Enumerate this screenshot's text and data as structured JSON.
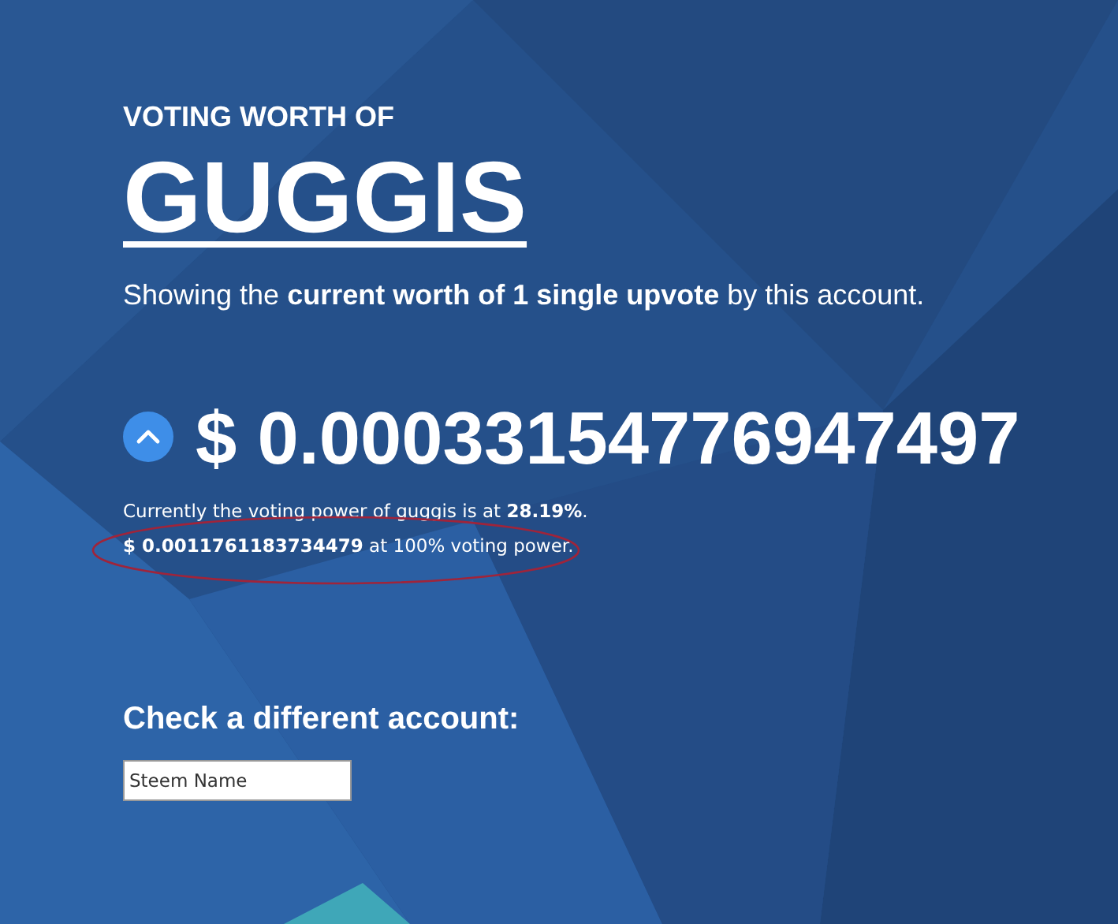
{
  "header": {
    "kicker": "VOTING WORTH OF",
    "account": "GUGGIS",
    "subtitle": "Showing the **current worth of 1 single upvote** by this account."
  },
  "worth": {
    "toggle_expanded": true,
    "value": "$ 0.00033154776947497"
  },
  "details": [
    "Currently the voting power of guggis is at **28.19%**.",
    "**$ 0.0011761183734479** at 100% voting power."
  ],
  "annotation": {
    "color": "#a0243a"
  },
  "lookup": {
    "heading": "Check a different account:",
    "placeholder": "Steem Name"
  }
}
